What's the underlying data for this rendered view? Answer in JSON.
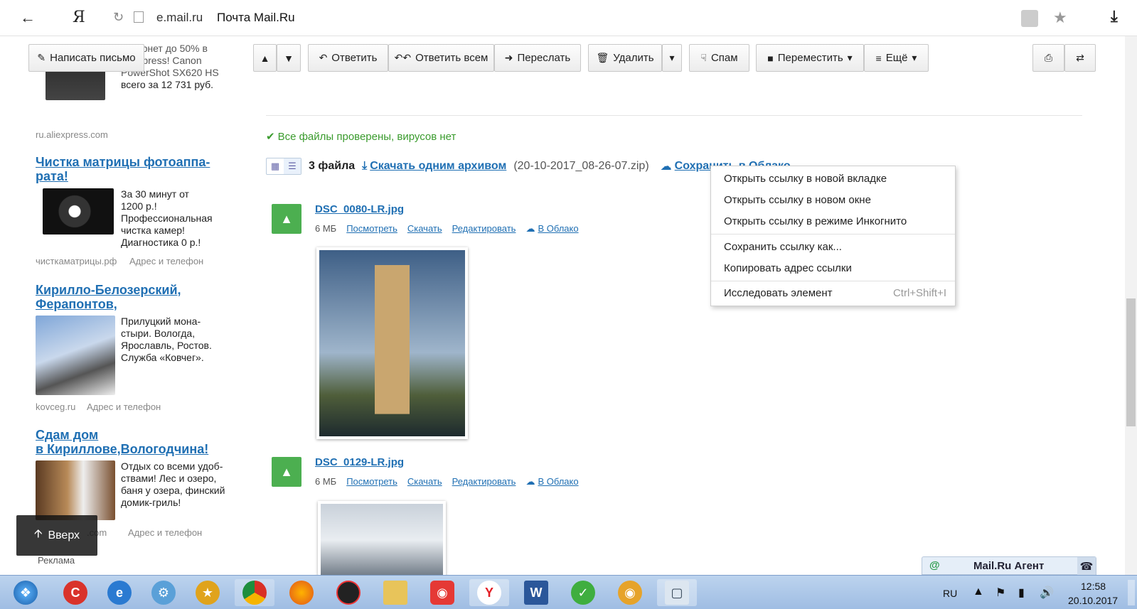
{
  "browser": {
    "domain": "e.mail.ru",
    "title": "Почта Mail.Ru",
    "yandex_glyph": "Я"
  },
  "toolbar": {
    "compose_label": "Написать письмо",
    "reply_label": "Ответить",
    "reply_all_label": "Ответить всем",
    "forward_label": "Переслать",
    "delete_label": "Удалить",
    "spam_label": "Спам",
    "move_label": "Переместить",
    "more_label": "Ещё"
  },
  "ads": {
    "top_partial": [
      "интернет до 50% в",
      "Aliexpress! Canon",
      "PowerShot SX620 HS",
      "всего за 12 731 руб."
    ],
    "ad1": {
      "source": "ru.aliexpress.com",
      "title_l1": "Чистка матрицы фотоаппа-",
      "title_l2": "рата!",
      "text": [
        "За 30 минут от",
        "1200 р.!",
        "Профессиональная",
        "чистка камер!",
        "Диагностика 0 р.!"
      ],
      "source2": "чисткаматрицы.рф",
      "contact": "Адрес и телефон"
    },
    "ad2": {
      "title_l1": "Кирилло-Белозерский,",
      "title_l2": "Ферапонтов,",
      "text": [
        "Прилуцкий мона-",
        "стыри. Вологда,",
        "Ярославль, Ростов.",
        "Служба «Ковчег»."
      ],
      "source": "kovceg.ru",
      "contact": "Адрес и телефон"
    },
    "ad3": {
      "title_l1": "Сдам дом",
      "title_l2": "в Кириллове,Вологодчина!",
      "text": [
        "Отдых со всеми удоб-",
        "ствами! Лес и озеро,",
        "баня у озера, финский",
        "домик-гриль!"
      ],
      "source_partial": ".com",
      "contact": "Адрес и телефон"
    },
    "footer": "Реклама"
  },
  "mail": {
    "virus_check": "Все файлы проверены, вирусов нет",
    "files_count": "3 файла",
    "download_archive": "Скачать одним архивом",
    "archive_name": "(20-10-2017_08-26-07.zip)",
    "save_cloud": "Сохранить в Облако",
    "files": [
      {
        "name": "DSC_0080-LR.jpg",
        "size": "6 МБ",
        "view": "Посмотреть",
        "download": "Скачать",
        "edit": "Редактировать",
        "cloud": "В Облако"
      },
      {
        "name": "DSC_0129-LR.jpg",
        "size": "6 МБ",
        "view": "Посмотреть",
        "download": "Скачать",
        "edit": "Редактировать",
        "cloud": "В Облако"
      }
    ]
  },
  "context_menu": {
    "items": [
      "Открыть ссылку в новой вкладке",
      "Открыть ссылку в новом окне",
      "Открыть ссылку в режиме Инкогнито",
      "Сохранить ссылку как...",
      "Копировать адрес ссылки",
      "Исследовать элемент"
    ],
    "inspect_shortcut": "Ctrl+Shift+I"
  },
  "up_button": "Вверх",
  "agent": {
    "label": "Mail.Ru Агент",
    "at": "@"
  },
  "taskbar": {
    "lang": "RU",
    "time": "12:58",
    "date": "20.10.2017"
  },
  "colors": {
    "link": "#1f6fb3",
    "ok_green": "#3a9b2d",
    "file_icon": "#4caf50"
  }
}
